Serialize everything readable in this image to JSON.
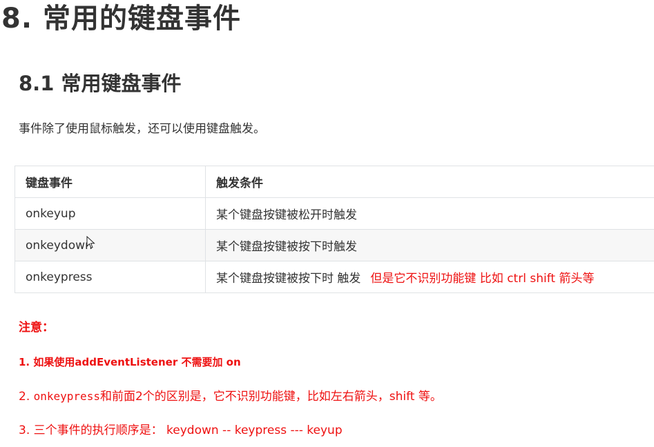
{
  "heading_main": "8. 常用的键盘事件",
  "heading_sub": "8.1 常用键盘事件",
  "intro": "事件除了使用鼠标触发，还可以使用键盘触发。",
  "table": {
    "headers": [
      "键盘事件",
      "触发条件"
    ],
    "rows": [
      {
        "event": "onkeyup",
        "condition": "某个键盘按键被松开时触发",
        "note": ""
      },
      {
        "event": "onkeydown",
        "condition": "某个键盘按键被按下时触发",
        "note": ""
      },
      {
        "event": "onkeypress",
        "condition": "某个键盘按键被按下时 触发",
        "note": "但是它不识别功能键 比如  ctrl shift 箭头等"
      }
    ]
  },
  "notes": {
    "title": "注意：",
    "item1": "1. 如果使用addEventListener 不需要加 on",
    "item2_prefix": "2. ",
    "item2_code": "onkeypress",
    "item2_rest": "和前面2个的区别是，它不识别功能键，比如左右箭头，shift 等。",
    "item3": "3.  三个事件的执行顺序是： keydown --  keypress  --- keyup"
  },
  "colors": {
    "text": "#333333",
    "red": "#ee1111",
    "border": "#dfe2e5",
    "row_alt": "#f7f7f7"
  }
}
